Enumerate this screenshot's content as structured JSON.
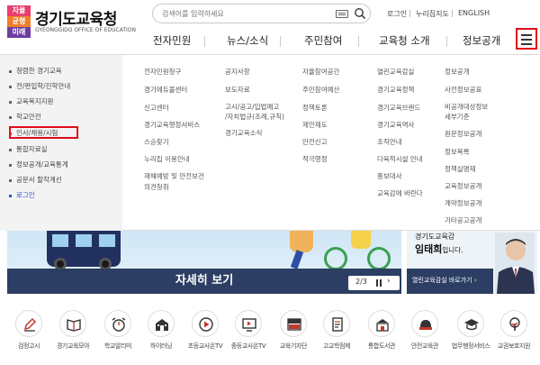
{
  "logo": {
    "mark_lines": [
      "자율",
      "균형",
      "미래"
    ],
    "name": "경기도교육청",
    "sub": "GYEONGGIDO OFFICE OF EDUCATION"
  },
  "search": {
    "placeholder": "검색어를 입력하세요"
  },
  "util": {
    "login": "로그인",
    "sitemap": "누리집지도",
    "english": "ENGLISH"
  },
  "gnb": [
    "전자민원",
    "뉴스/소식",
    "주민참여",
    "교육청 소개",
    "정보공개"
  ],
  "sidebar": {
    "items": [
      {
        "label": "청렴한 경기교육"
      },
      {
        "label": "전/편입학/진학안내"
      },
      {
        "label": "교육복지지원"
      },
      {
        "label": "학교안전"
      },
      {
        "label": "인사/채용/시험"
      },
      {
        "label": "통합자료실"
      },
      {
        "label": "정보공개/교육통계"
      },
      {
        "label": "공문서 할착계선"
      },
      {
        "label": "로그인"
      }
    ]
  },
  "mega": {
    "col1": [
      "전자민원청구",
      "경기에듀콜센터",
      "신고센터",
      "경기교육행정서비스",
      "스승찾기",
      "누리집 이용안내",
      "재해예방 및 안전보건",
      "의견청취"
    ],
    "col2": [
      "공지사항",
      "보도자료",
      "고시/공고/입법예고",
      "/자치법규(조례,규칙)",
      "경기교육소식"
    ],
    "col3": [
      "자율참여공간",
      "주민참여예산",
      "정책토론",
      "제안제도",
      "안전신고",
      "적극행정"
    ],
    "col4": [
      "열린교육감실",
      "경기교육정책",
      "경기교육브랜드",
      "경기교육역사",
      "조직안내",
      "다육적시설 안내",
      "홍보대사",
      "교육감에 바란다"
    ],
    "col5": [
      "정보공개",
      "사전정보공표",
      "비공개대상정보",
      "세부기준",
      "원문정보공개",
      "정보목록",
      "정책실명제",
      "교육정보공개",
      "계약정보공개",
      "기타공고공개"
    ]
  },
  "banner": {
    "title": "자세히 보기",
    "pager_label": "2/3",
    "next_glyph": "›"
  },
  "promo": {
    "line1": "경기도교육감",
    "name": "임태희",
    "suffix": "입니다.",
    "button": "열린교육감실 바로가기 ›"
  },
  "quick": [
    {
      "label": "검정고시",
      "icon": "pen-icon"
    },
    {
      "label": "경기교육모아",
      "icon": "book-icon"
    },
    {
      "label": "학교알리미",
      "icon": "alarm-icon"
    },
    {
      "label": "하이러닝",
      "icon": "school-icon"
    },
    {
      "label": "초등교사온TV",
      "icon": "play-icon"
    },
    {
      "label": "중등교사온TV",
      "icon": "monitor-icon"
    },
    {
      "label": "교육기자단",
      "icon": "news-icon"
    },
    {
      "label": "고교학점제",
      "icon": "document-icon"
    },
    {
      "label": "통합도서관",
      "icon": "library-icon"
    },
    {
      "label": "안전교육관",
      "icon": "helmet-icon"
    },
    {
      "label": "법무행정서비스",
      "icon": "graduation-cap-icon"
    },
    {
      "label": "교권보호지원",
      "icon": "tree-icon"
    }
  ],
  "colors": {
    "highlight": "#e10d1a",
    "banner_bar": "#2c3e63",
    "active_link": "#2255cc"
  }
}
